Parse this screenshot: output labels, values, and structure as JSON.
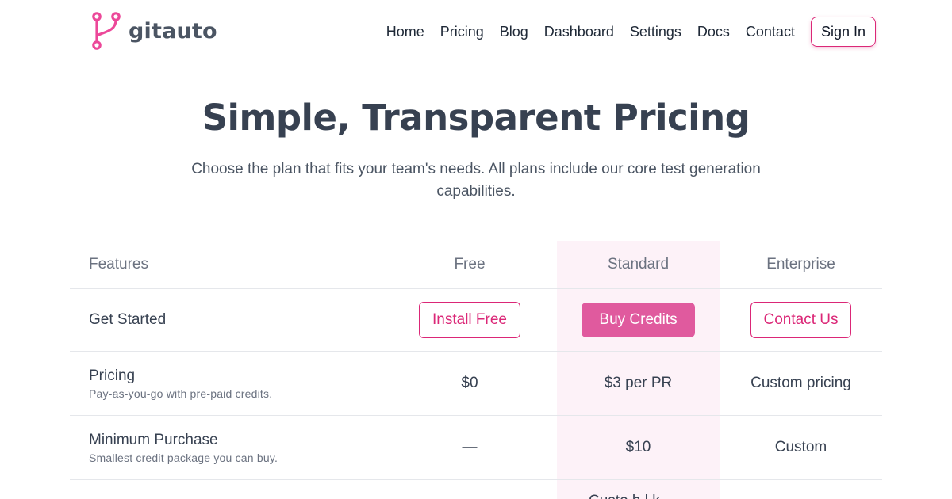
{
  "brand": {
    "name": "gitauto",
    "icon": "git-branch-icon",
    "color": "#ec4899"
  },
  "nav": {
    "links": [
      "Home",
      "Pricing",
      "Blog",
      "Dashboard",
      "Settings",
      "Docs",
      "Contact"
    ],
    "sign_in": "Sign In"
  },
  "hero": {
    "title": "Simple, Transparent Pricing",
    "subtitle": "Choose the plan that fits your team's needs. All plans include our core test generation capabilities."
  },
  "table": {
    "headers": {
      "features": "Features",
      "free": "Free",
      "standard": "Standard",
      "enterprise": "Enterprise"
    },
    "get_started": {
      "label": "Get Started",
      "free_button": "Install Free",
      "standard_button": "Buy Credits",
      "enterprise_button": "Contact Us"
    },
    "pricing": {
      "label": "Pricing",
      "description": "Pay-as-you-go with pre-paid credits.",
      "free": "$0",
      "standard": "$3 per PR",
      "enterprise": "Custom pricing"
    },
    "minimum_purchase": {
      "label": "Minimum Purchase",
      "description": "Smallest credit package you can buy.",
      "free": "—",
      "standard": "$10",
      "enterprise": "Custom"
    },
    "next_row_partial": "Custo     h    l   k    "
  },
  "colors": {
    "accent": "#db2777",
    "accent_fill": "#e05a9e",
    "highlight_column": "#fdf2f8"
  }
}
